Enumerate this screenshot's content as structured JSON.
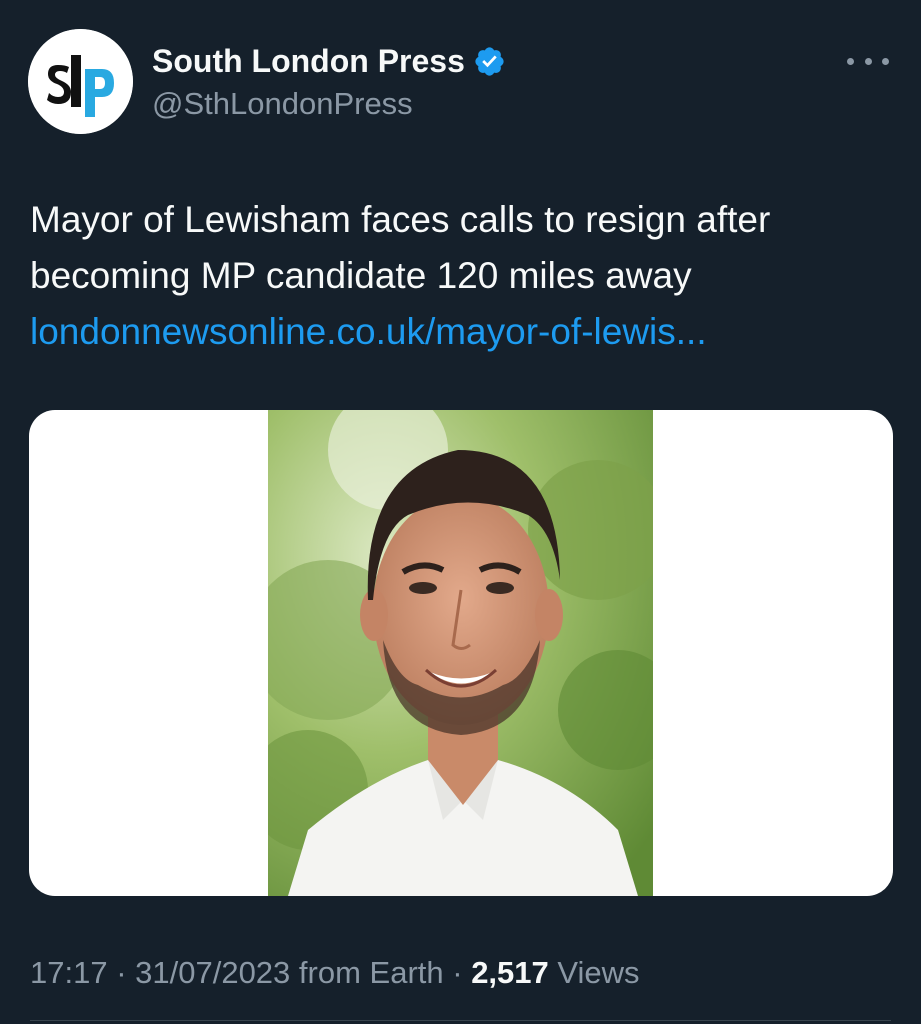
{
  "author": {
    "display_name": "South London Press",
    "handle": "@SthLondonPress",
    "avatar_text": "slp",
    "verified": true
  },
  "tweet": {
    "text_line1": "Mayor of Lewisham faces calls to resign after",
    "text_line2": "becoming MP candidate 120 miles away",
    "link_text": "londonnewsonline.co.uk/mayor-of-lewis..."
  },
  "meta": {
    "time": "17:17",
    "sep1": " · ",
    "date": "31/07/2023",
    "source": " from Earth",
    "sep2": " · ",
    "views_count": "2,517",
    "views_label": " Views"
  },
  "colors": {
    "background": "#15202b",
    "text": "#f7f9f9",
    "secondary": "#8b98a5",
    "link": "#1d9bf0",
    "verified_badge": "#1d9bf0"
  },
  "icons": {
    "more": "more-horizontal-icon",
    "verified": "verified-badge-icon"
  }
}
